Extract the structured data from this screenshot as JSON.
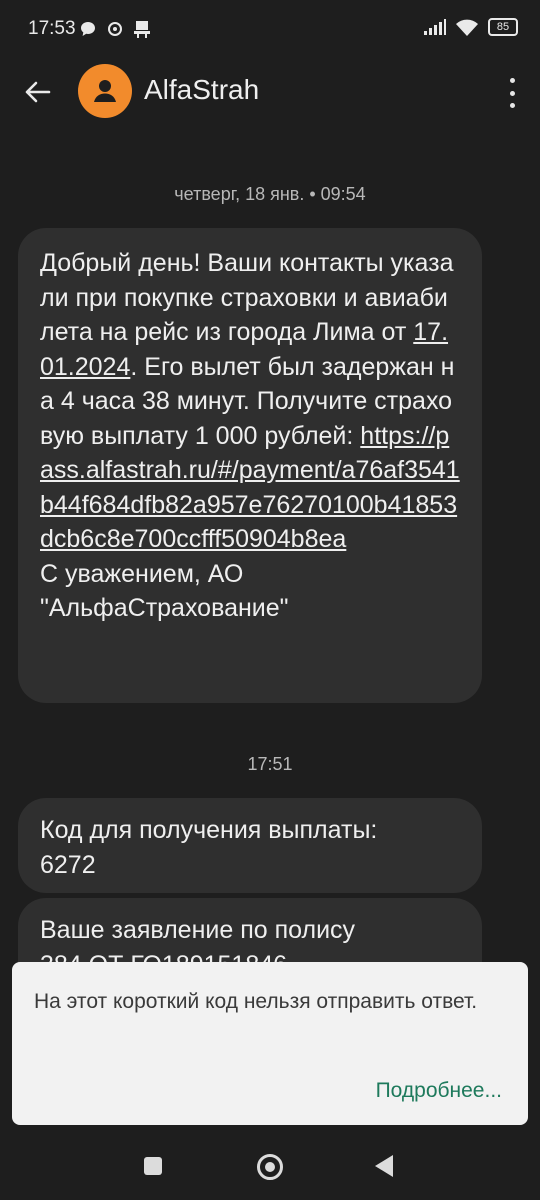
{
  "status": {
    "time": "17:53",
    "battery": "85",
    "left_icons": [
      "chat-bubble-icon",
      "gear-like-icon",
      "cast-icon"
    ],
    "right_icons": [
      "signal-icon",
      "wifi-icon",
      "battery-icon"
    ]
  },
  "header": {
    "title": "AlfaStrah",
    "avatar_color": "#f28b2c"
  },
  "conversation": {
    "date_stamp": "четверг, 18 янв. • 09:54",
    "message1": {
      "text_before": "Добрый день! Ваши контакты указали при покупке страховки и авиабилета на рейс из города Лима от ",
      "date_link": "17.01.2024",
      "text_middle": ". Его вылет был задержан на 4 часа 38 минут. Получите страховую выплату 1 000 рублей: ",
      "url": "https://pass.alfastrah.ru/#/payment/a76af3541b44f684dfb82a957e76270100b41853dcb6c8e700ccfff50904b8ea",
      "signature_line1": "С уважением, АО",
      "signature_line2": "\"АльфаСтрахование\""
    },
    "time_stamp2": "17:51",
    "message2": {
      "line1": "Код для получения выплаты:",
      "line2": "6272"
    },
    "message3": {
      "line1": "Ваше заявление по полису",
      "line2": "384 ОТ ГО189151846"
    }
  },
  "snackbar": {
    "text": "На этот короткий код нельзя отправить ответ.",
    "action": "Подробнее..."
  }
}
